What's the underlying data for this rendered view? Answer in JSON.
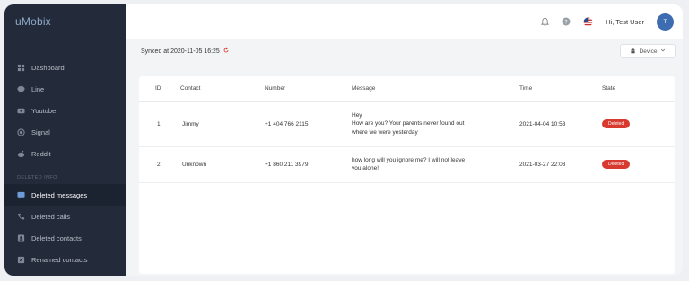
{
  "app": {
    "logo": "uMobix"
  },
  "sidebar": {
    "items": [
      {
        "label": "Dashboard",
        "icon": "dashboard-icon"
      },
      {
        "label": "Line",
        "icon": "line-icon"
      },
      {
        "label": "Youtube",
        "icon": "youtube-icon"
      },
      {
        "label": "Signal",
        "icon": "signal-icon"
      },
      {
        "label": "Reddit",
        "icon": "reddit-icon"
      }
    ],
    "section_label": "DELETED INFO",
    "deleted_items": [
      {
        "label": "Deleted messages",
        "icon": "message-icon",
        "active": true
      },
      {
        "label": "Deleted calls",
        "icon": "phone-icon"
      },
      {
        "label": "Deleted contacts",
        "icon": "contacts-icon"
      },
      {
        "label": "Renamed contacts",
        "icon": "edit-icon"
      }
    ]
  },
  "header": {
    "greeting": "Hi, Test User",
    "avatar_initial": "T"
  },
  "sync": {
    "text": "Synced at 2020-11-05 16:25"
  },
  "device": {
    "label": "Device"
  },
  "table": {
    "columns": {
      "id": "ID",
      "contact": "Contact",
      "number": "Number",
      "message": "Message",
      "time": "Time",
      "state": "State"
    },
    "rows": [
      {
        "id": "1",
        "contact": "Jimmy",
        "number": "+1 404 766 2115",
        "message_lines": [
          "Hey",
          "How are you? Your parents never found out",
          "where we were yesterday"
        ],
        "time": "2021-04-04 10:53",
        "state": "Deleted"
      },
      {
        "id": "2",
        "contact": "Unknown",
        "number": "+1 860 211 3979",
        "message_lines": [
          "how long will you ignore me? I will not leave",
          "you alone!"
        ],
        "time": "2021-03-27 22:03",
        "state": "Deleted"
      }
    ]
  },
  "colors": {
    "sidebar_bg": "#232b3a",
    "accent": "#3d6db0",
    "deleted_badge": "#d93a2f"
  }
}
